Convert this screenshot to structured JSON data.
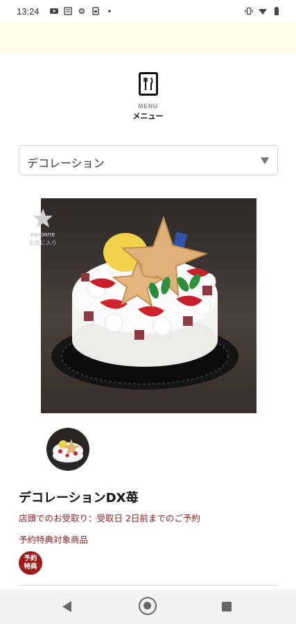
{
  "status_bar": {
    "time": "13:24",
    "left_icons": [
      "youtube-icon",
      "notification-icon",
      "settings-icon",
      "storage-icon",
      "dot-icon"
    ],
    "right_icons": [
      "vibrate-icon",
      "wifi-icon",
      "battery-icon"
    ]
  },
  "header": {
    "menu_en": "MENU",
    "menu_ja": "メニュー",
    "icon": "restaurant-menu-icon"
  },
  "category": {
    "selected": "デコレーション"
  },
  "favorite": {
    "label_en": "FAVORITE",
    "label_ja": "お気に入り",
    "icon": "star-icon"
  },
  "product": {
    "name": "デコレーションDX苺",
    "pickup_note": "店頭でのお受取り：受取日 2日前までのご予約",
    "benefit_note": "予約特典対象商品",
    "badge_line1": "予約",
    "badge_line2": "特典"
  },
  "nav_bar": {
    "icons": [
      "back-icon",
      "home-icon",
      "recent-apps-icon"
    ]
  },
  "colors": {
    "accent_red": "#8b1d1d",
    "badge_red": "#9c1b1b",
    "banner_yellow": "#fffbe6"
  }
}
